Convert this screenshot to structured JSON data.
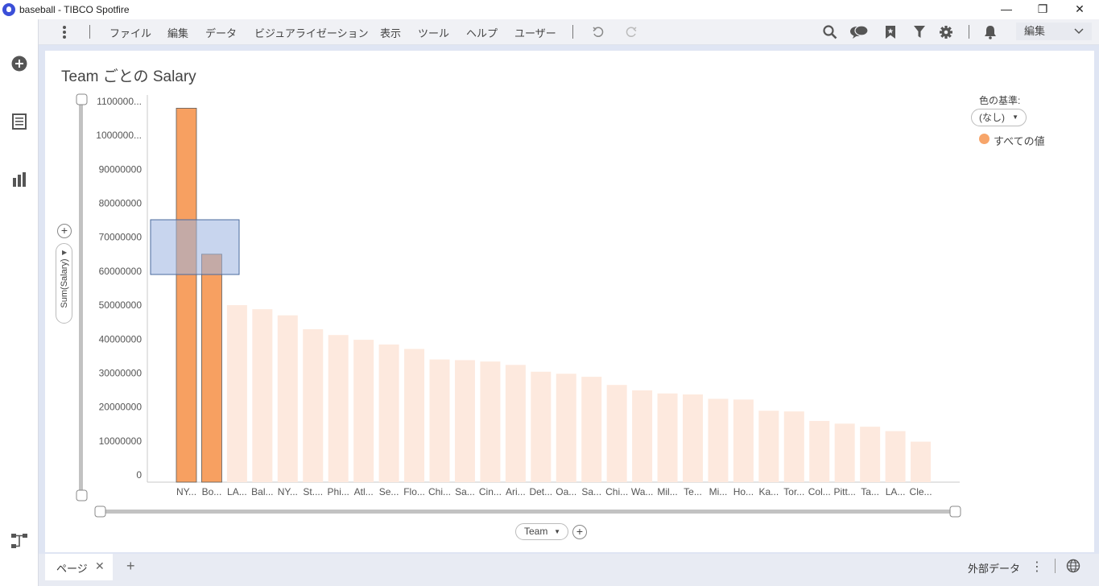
{
  "window": {
    "title": "baseball - TIBCO Spotfire",
    "controls": {
      "minimize": "—",
      "restore": "❐",
      "close": "✕"
    }
  },
  "toolbar": {
    "menu": [
      "ファイル",
      "編集",
      "データ",
      "ビジュアライゼーション",
      "表示",
      "ツール",
      "ヘルプ",
      "ユーザー"
    ],
    "edit_mode": "編集",
    "icons": [
      "more-vertical-icon",
      "undo-icon",
      "redo-icon",
      "search-icon",
      "comments-icon",
      "bookmark-icon",
      "filter-icon",
      "settings-icon",
      "notification-icon"
    ]
  },
  "left_rail": {
    "icons": [
      "add-icon",
      "data-table-icon",
      "visualization-icon",
      "data-canvas-icon"
    ]
  },
  "visualization": {
    "title": "Team ごとの Salary",
    "y_axis_label": "Sum(Salary)",
    "x_axis_label": "Team",
    "legend": {
      "title": "色の基準:",
      "selector": "(なし)",
      "entry": "すべての値",
      "entry_color": "#f7a56a"
    }
  },
  "chart_data": {
    "type": "bar",
    "ylim": [
      0,
      110000000
    ],
    "yticks": [
      "0",
      "10000000",
      "20000000",
      "30000000",
      "40000000",
      "50000000",
      "60000000",
      "70000000",
      "80000000",
      "90000000",
      "1000000...",
      "1100000..."
    ],
    "ytick_values": [
      0,
      10000000,
      20000000,
      30000000,
      40000000,
      50000000,
      60000000,
      70000000,
      80000000,
      90000000,
      100000000,
      110000000
    ],
    "categories": [
      "NY...",
      "Bo...",
      "LA...",
      "Bal...",
      "NY...",
      "St....",
      "Phi...",
      "Atl...",
      "Se...",
      "Flo...",
      "Chi...",
      "Sa...",
      "Cin...",
      "Ari...",
      "Det...",
      "Oa...",
      "Sa...",
      "Chi...",
      "Wa...",
      "Mil...",
      "Te...",
      "Mi...",
      "Ho...",
      "Ka...",
      "Tor...",
      "Col...",
      "Pitt...",
      "Ta...",
      "LA...",
      "Cle..."
    ],
    "values": [
      108000000,
      65000000,
      50000000,
      48800000,
      47000000,
      42900000,
      41200000,
      39800000,
      38400000,
      37100000,
      34000000,
      33800000,
      33400000,
      32400000,
      30400000,
      29800000,
      28900000,
      26500000,
      24900000,
      24000000,
      23700000,
      22400000,
      22200000,
      18900000,
      18700000,
      15900000,
      15100000,
      14200000,
      12900000,
      9800000
    ],
    "marked": [
      true,
      true,
      false,
      false,
      false,
      false,
      false,
      false,
      false,
      false,
      false,
      false,
      false,
      false,
      false,
      false,
      false,
      false,
      false,
      false,
      false,
      false,
      false,
      false,
      false,
      false,
      false,
      false,
      false,
      false
    ],
    "colors": {
      "marked": "#f7a061",
      "unmarked": "#fde9de",
      "marked_border": "#5a5a5a"
    },
    "grid": false,
    "legend_position": "top-right"
  },
  "bottom": {
    "page_tab": "ページ",
    "close": "✕",
    "add": "+",
    "external_data": "外部データ",
    "more": "⋮"
  }
}
